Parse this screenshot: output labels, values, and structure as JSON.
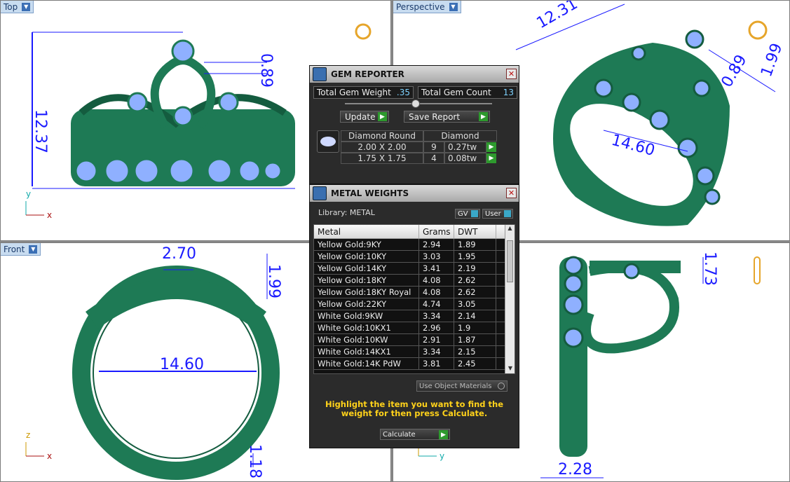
{
  "viewports": {
    "top": {
      "label": "Top",
      "dims": [
        "12.37",
        "0.89"
      ],
      "axes": [
        "y",
        "x"
      ]
    },
    "perspective": {
      "label": "Perspective",
      "dims": [
        "12.31",
        "0.89",
        "1.99",
        "14.60"
      ]
    },
    "front": {
      "label": "Front",
      "dims": [
        "2.70",
        "1.99",
        "14.60",
        "1.18"
      ],
      "axes": [
        "z",
        "x"
      ]
    },
    "right": {
      "dims": [
        "1.73",
        "2.28"
      ],
      "axes": [
        "z",
        "y"
      ]
    }
  },
  "gem_reporter": {
    "title": "GEM REPORTER",
    "total_weight_label": "Total Gem Weight",
    "total_weight": ".35",
    "total_count_label": "Total Gem Count",
    "total_count": "13",
    "update_label": "Update",
    "save_report_label": "Save Report",
    "header_shape": "Diamond Round",
    "header_type": "Diamond",
    "rows": [
      {
        "size": "2.00 X 2.00",
        "count": "9",
        "weight": "0.27tw"
      },
      {
        "size": "1.75 X 1.75",
        "count": "4",
        "weight": "0.08tw"
      }
    ]
  },
  "metal_weights": {
    "title": "METAL WEIGHTS",
    "library_label": "Library: METAL",
    "gv_label": "GV",
    "user_label": "User",
    "columns": [
      "Metal",
      "Grams",
      "DWT"
    ],
    "rows": [
      {
        "metal": "Yellow Gold:9KY",
        "grams": "2.94",
        "dwt": "1.89"
      },
      {
        "metal": "Yellow Gold:10KY",
        "grams": "3.03",
        "dwt": "1.95"
      },
      {
        "metal": "Yellow Gold:14KY",
        "grams": "3.41",
        "dwt": "2.19"
      },
      {
        "metal": "Yellow Gold:18KY",
        "grams": "4.08",
        "dwt": "2.62"
      },
      {
        "metal": "Yellow Gold:18KY Royal",
        "grams": "4.08",
        "dwt": "2.62"
      },
      {
        "metal": "Yellow Gold:22KY",
        "grams": "4.74",
        "dwt": "3.05"
      },
      {
        "metal": "White Gold:9KW",
        "grams": "3.34",
        "dwt": "2.14"
      },
      {
        "metal": "White Gold:10KX1",
        "grams": "2.96",
        "dwt": "1.9"
      },
      {
        "metal": "White Gold:10KW",
        "grams": "2.91",
        "dwt": "1.87"
      },
      {
        "metal": "White Gold:14KX1",
        "grams": "3.34",
        "dwt": "2.15"
      },
      {
        "metal": "White Gold:14K PdW",
        "grams": "3.81",
        "dwt": "2.45"
      }
    ],
    "use_object_materials_label": "Use Object Materials",
    "hint": "Highlight the item you want to find the weight for then press Calculate.",
    "calculate_label": "Calculate"
  },
  "colors": {
    "ring": "#1e7a55",
    "gem": "#7fa6ff",
    "dim": "#1a1aff",
    "hint": "#ffd21a"
  }
}
